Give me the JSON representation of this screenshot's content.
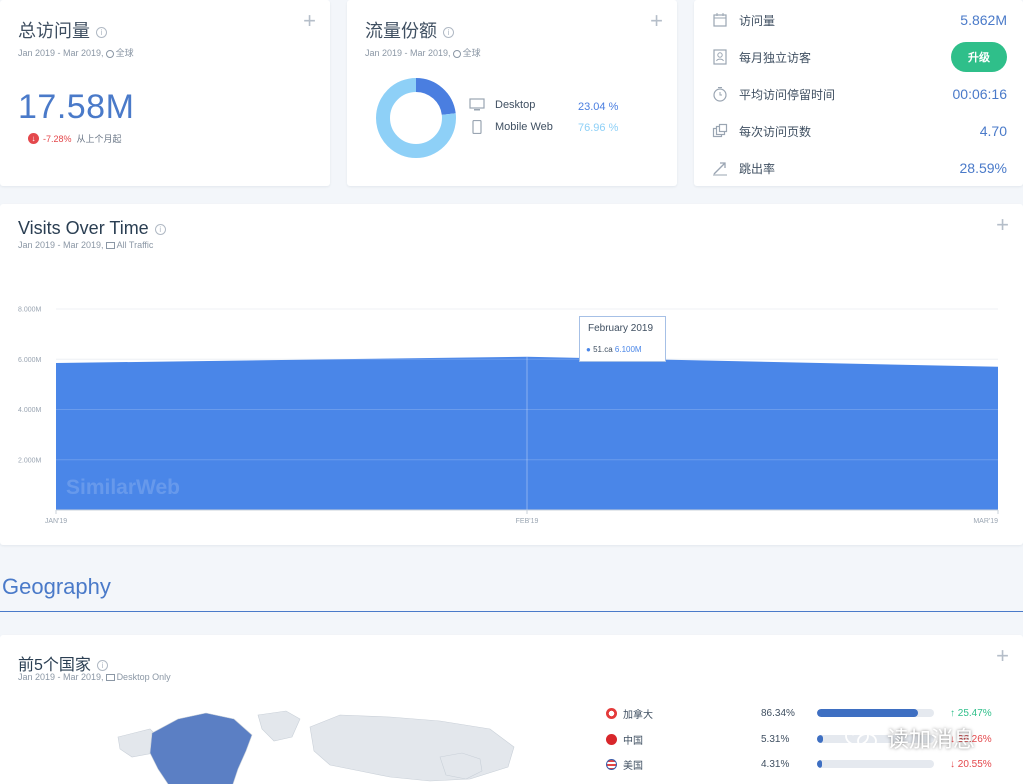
{
  "visits_card": {
    "title": "总访问量",
    "date_range": "Jan 2019 - Mar 2019,",
    "scope": "全球",
    "value": "17.58M",
    "change": "-7.28%",
    "change_note": "从上个月起"
  },
  "share_card": {
    "title": "流量份额",
    "date_range": "Jan 2019 - Mar 2019,",
    "scope": "全球",
    "devices": [
      {
        "name": "Desktop",
        "pct": "23.04 %",
        "value": 23.04,
        "color": "#4a7ee0"
      },
      {
        "name": "Mobile Web",
        "pct": "76.96 %",
        "value": 76.96,
        "color": "#8ed0f7"
      }
    ]
  },
  "kpi_card": {
    "rows": [
      {
        "label": "访问量",
        "value": "5.862M",
        "icon": "calendar-icon"
      },
      {
        "label": "每月独立访客",
        "button": "升级",
        "icon": "visitor-icon"
      },
      {
        "label": "平均访问停留时间",
        "value": "00:06:16",
        "icon": "clock-icon"
      },
      {
        "label": "每次访问页数",
        "value": "4.70",
        "icon": "pages-icon"
      },
      {
        "label": "跳出率",
        "value": "28.59%",
        "icon": "bounce-icon"
      }
    ]
  },
  "visits_over_time": {
    "title": "Visits Over Time",
    "date_range": "Jan 2019 - Mar 2019,",
    "scope": "All Traffic",
    "watermark": "SimilarWeb",
    "tooltip": {
      "title": "February 2019",
      "site": "51.ca",
      "value": "6.100M"
    }
  },
  "chart_data": {
    "type": "area",
    "x": [
      "JAN'19",
      "FEB'19",
      "MAR'19"
    ],
    "series": [
      {
        "name": "51.ca",
        "values": [
          5.85,
          6.1,
          5.7
        ],
        "color": "#4a86e8"
      }
    ],
    "yticks": [
      "2.000M",
      "4.000M",
      "6.000M",
      "8.000M"
    ],
    "ylim": [
      0,
      8
    ],
    "grid": true
  },
  "geography": {
    "heading": "Geography"
  },
  "countries_card": {
    "title": "前5个国家",
    "date_range": "Jan 2019 - Mar 2019,",
    "scope": "Desktop Only",
    "rows": [
      {
        "name": "加拿大",
        "pct": "86.34%",
        "share": 86.34,
        "change": "25.47%",
        "dir": "up",
        "arrow": "↑",
        "flag": "#e43b3b"
      },
      {
        "name": "中国",
        "pct": "5.31%",
        "share": 5.31,
        "change": "36.26%",
        "dir": "dn",
        "arrow": "↓",
        "flag": "#d8262b"
      },
      {
        "name": "美国",
        "pct": "4.31%",
        "share": 4.31,
        "change": "20.55%",
        "dir": "dn",
        "arrow": "↓",
        "flag": "#3a5ba8"
      }
    ]
  },
  "overlay": {
    "text": "读加消息"
  }
}
